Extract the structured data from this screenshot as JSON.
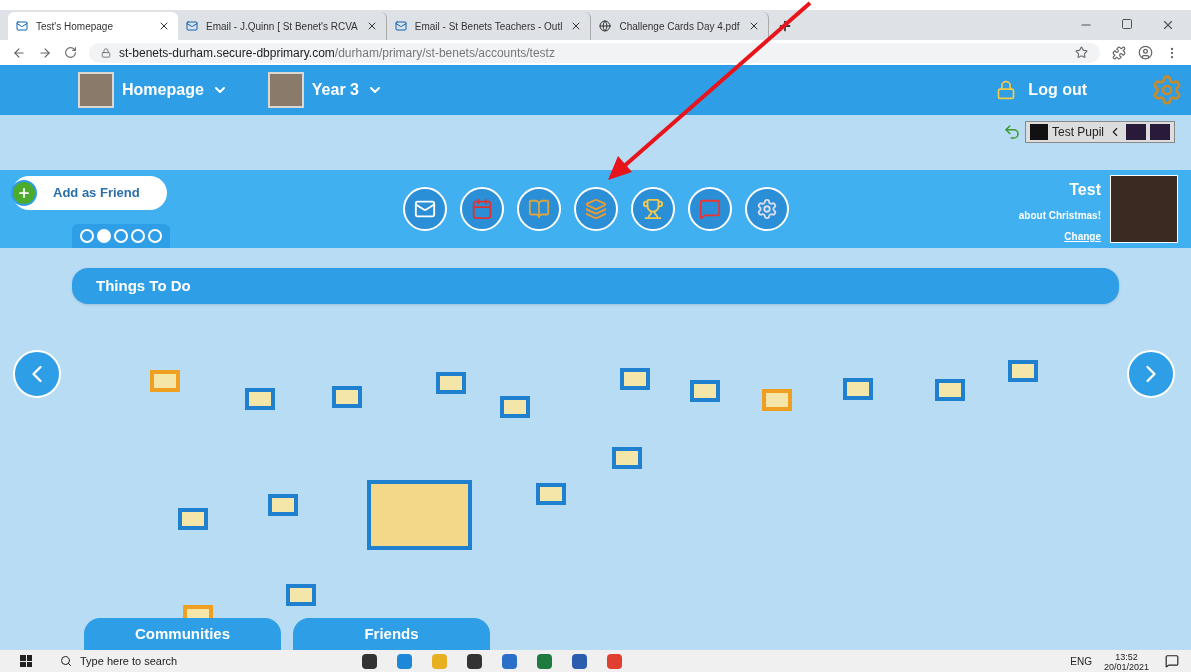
{
  "browser": {
    "tabs": [
      {
        "title": "Test's Homepage",
        "selected": true
      },
      {
        "title": "Email - J.Quinn [ St Benet's RCVA",
        "selected": false
      },
      {
        "title": "Email - St Benets Teachers - Outl",
        "selected": false
      },
      {
        "title": "Challenge Cards Day 4.pdf",
        "selected": false
      }
    ],
    "url_host": "st-benets-durham.secure-dbprimary.com",
    "url_path": "/durham/primary/st-benets/accounts/testz"
  },
  "header": {
    "menus": [
      "Homepage",
      "Year 3"
    ],
    "logout": "Log out",
    "pupil": "Test Pupil"
  },
  "profile_bar": {
    "add_friend": "Add as Friend",
    "pages": [
      {
        "selected": false
      },
      {
        "selected": true
      },
      {
        "selected": false
      },
      {
        "selected": false
      },
      {
        "selected": false
      }
    ],
    "name": "Test",
    "status": "about Christmas!",
    "change": "Change"
  },
  "things_to_do": {
    "title": "Things To Do"
  },
  "bottom_tabs": [
    "Communities",
    "Friends"
  ],
  "taskbar": {
    "search_placeholder": "Type here to search",
    "language": "ENG",
    "time": "13:52",
    "date": "20/01/2021"
  }
}
